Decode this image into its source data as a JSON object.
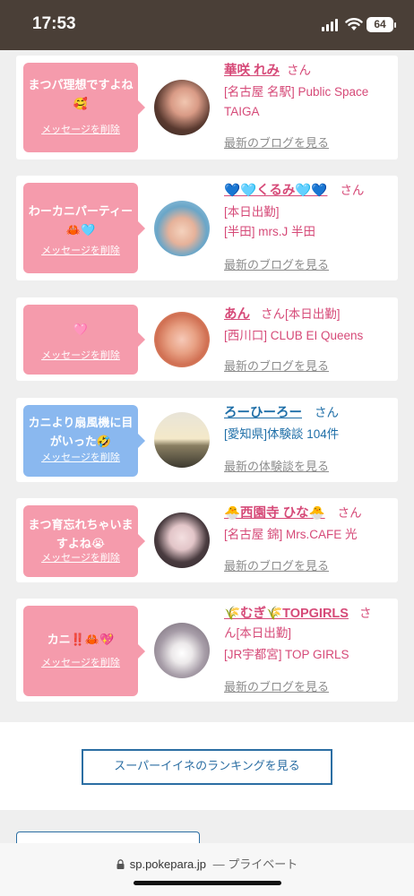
{
  "status_bar": {
    "time": "17:53",
    "battery": "64"
  },
  "messages": [
    {
      "message": "まつパ理想ですよね🥰",
      "delete_label": "メッセージを削除",
      "name": "華咲 れみ",
      "san": "さん",
      "line2": "[名古屋 名駅] Public Space TAIGA",
      "line3": "",
      "blog_link": "最新のブログを見る",
      "bubble_color": "#f59bac"
    },
    {
      "message": "わーカニパーティー🦀🩵",
      "delete_label": "メッセージを削除",
      "name": "💙🩵くるみ🩵💙",
      "san": "さん",
      "line2": "[本日出勤]",
      "line3": "[半田] mrs.J 半田",
      "blog_link": "最新のブログを見る",
      "bubble_color": "#f59bac"
    },
    {
      "message": "🩷",
      "delete_label": "メッセージを削除",
      "name": "あん",
      "san": "さん",
      "inline_extra": "[本日出勤]",
      "line2": "[西川口] CLUB EI Queens",
      "line3": "",
      "blog_link": "最新のブログを見る",
      "bubble_color": "#f59bac"
    },
    {
      "message": "カニより扇風機に目がいった🤣",
      "delete_label": "メッセージを削除",
      "name": "ろーひーろー",
      "san": "さん",
      "line2": "[愛知県]体験談 104件",
      "line3": "",
      "blog_link": "最新の体験談を見る",
      "bubble_color": "#8ab8ef"
    },
    {
      "message": "まつ育忘れちゃいますよね😭",
      "delete_label": "メッセージを削除",
      "name": "🐣西園寺 ひな🐣",
      "san": "さん",
      "line2": "[名古屋 錦] Mrs.CAFE 光",
      "line3": "",
      "blog_link": "最新のブログを見る",
      "bubble_color": "#f59bac"
    },
    {
      "message": "カニ‼️🦀💖",
      "delete_label": "メッセージを削除",
      "name": "🌾むぎ🌾TOPGIRLS",
      "san": "さ",
      "line1b": "ん[本日出勤]",
      "line2": "[JR宇都宮] TOP GIRLS",
      "line3": "",
      "blog_link": "最新のブログを見る",
      "bubble_color": "#f59bac"
    }
  ],
  "ranking_button": "スーパーイイネのランキングを見る",
  "url_bar": {
    "domain": "sp.pokepara.jp",
    "suffix": "— プライベート"
  }
}
